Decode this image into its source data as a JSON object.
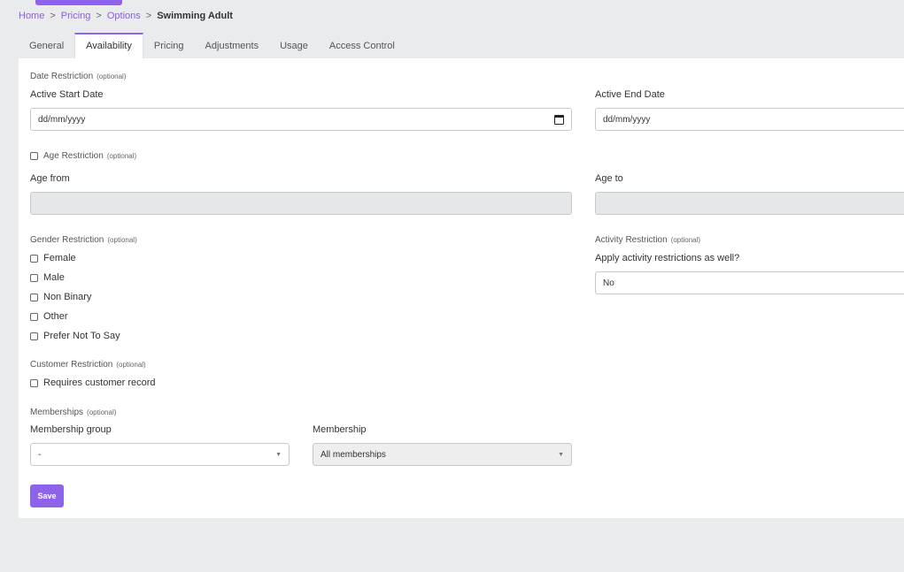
{
  "breadcrumb": {
    "home": "Home",
    "pricing": "Pricing",
    "options": "Options",
    "current": "Swimming Adult",
    "sep": ">"
  },
  "tabs": [
    {
      "label": "General"
    },
    {
      "label": "Availability"
    },
    {
      "label": "Pricing"
    },
    {
      "label": "Adjustments"
    },
    {
      "label": "Usage"
    },
    {
      "label": "Access Control"
    }
  ],
  "date_restriction": {
    "title": "Date Restriction",
    "optional": "(optional)",
    "start_label": "Active Start Date",
    "start_placeholder": "dd/mm/yyyy",
    "end_label": "Active End Date",
    "end_placeholder": "dd/mm/yyyy"
  },
  "age_restriction": {
    "title": "Age Restriction",
    "optional": "(optional)",
    "from_label": "Age from",
    "to_label": "Age to"
  },
  "gender_restriction": {
    "title": "Gender Restriction",
    "optional": "(optional)",
    "options": [
      "Female",
      "Male",
      "Non Binary",
      "Other",
      "Prefer Not To Say"
    ]
  },
  "activity_restriction": {
    "title": "Activity Restriction",
    "optional": "(optional)",
    "question": "Apply activity restrictions as well?",
    "value": "No"
  },
  "customer_restriction": {
    "title": "Customer Restriction",
    "optional": "(optional)",
    "checkbox_label": "Requires customer record"
  },
  "memberships": {
    "title": "Memberships",
    "optional": "(optional)",
    "group_label": "Membership group",
    "group_value": "-",
    "membership_label": "Membership",
    "membership_value": "All memberships"
  },
  "save_label": "Save",
  "colors": {
    "accent": "#8f63e8",
    "link": "#8a5ce6"
  }
}
